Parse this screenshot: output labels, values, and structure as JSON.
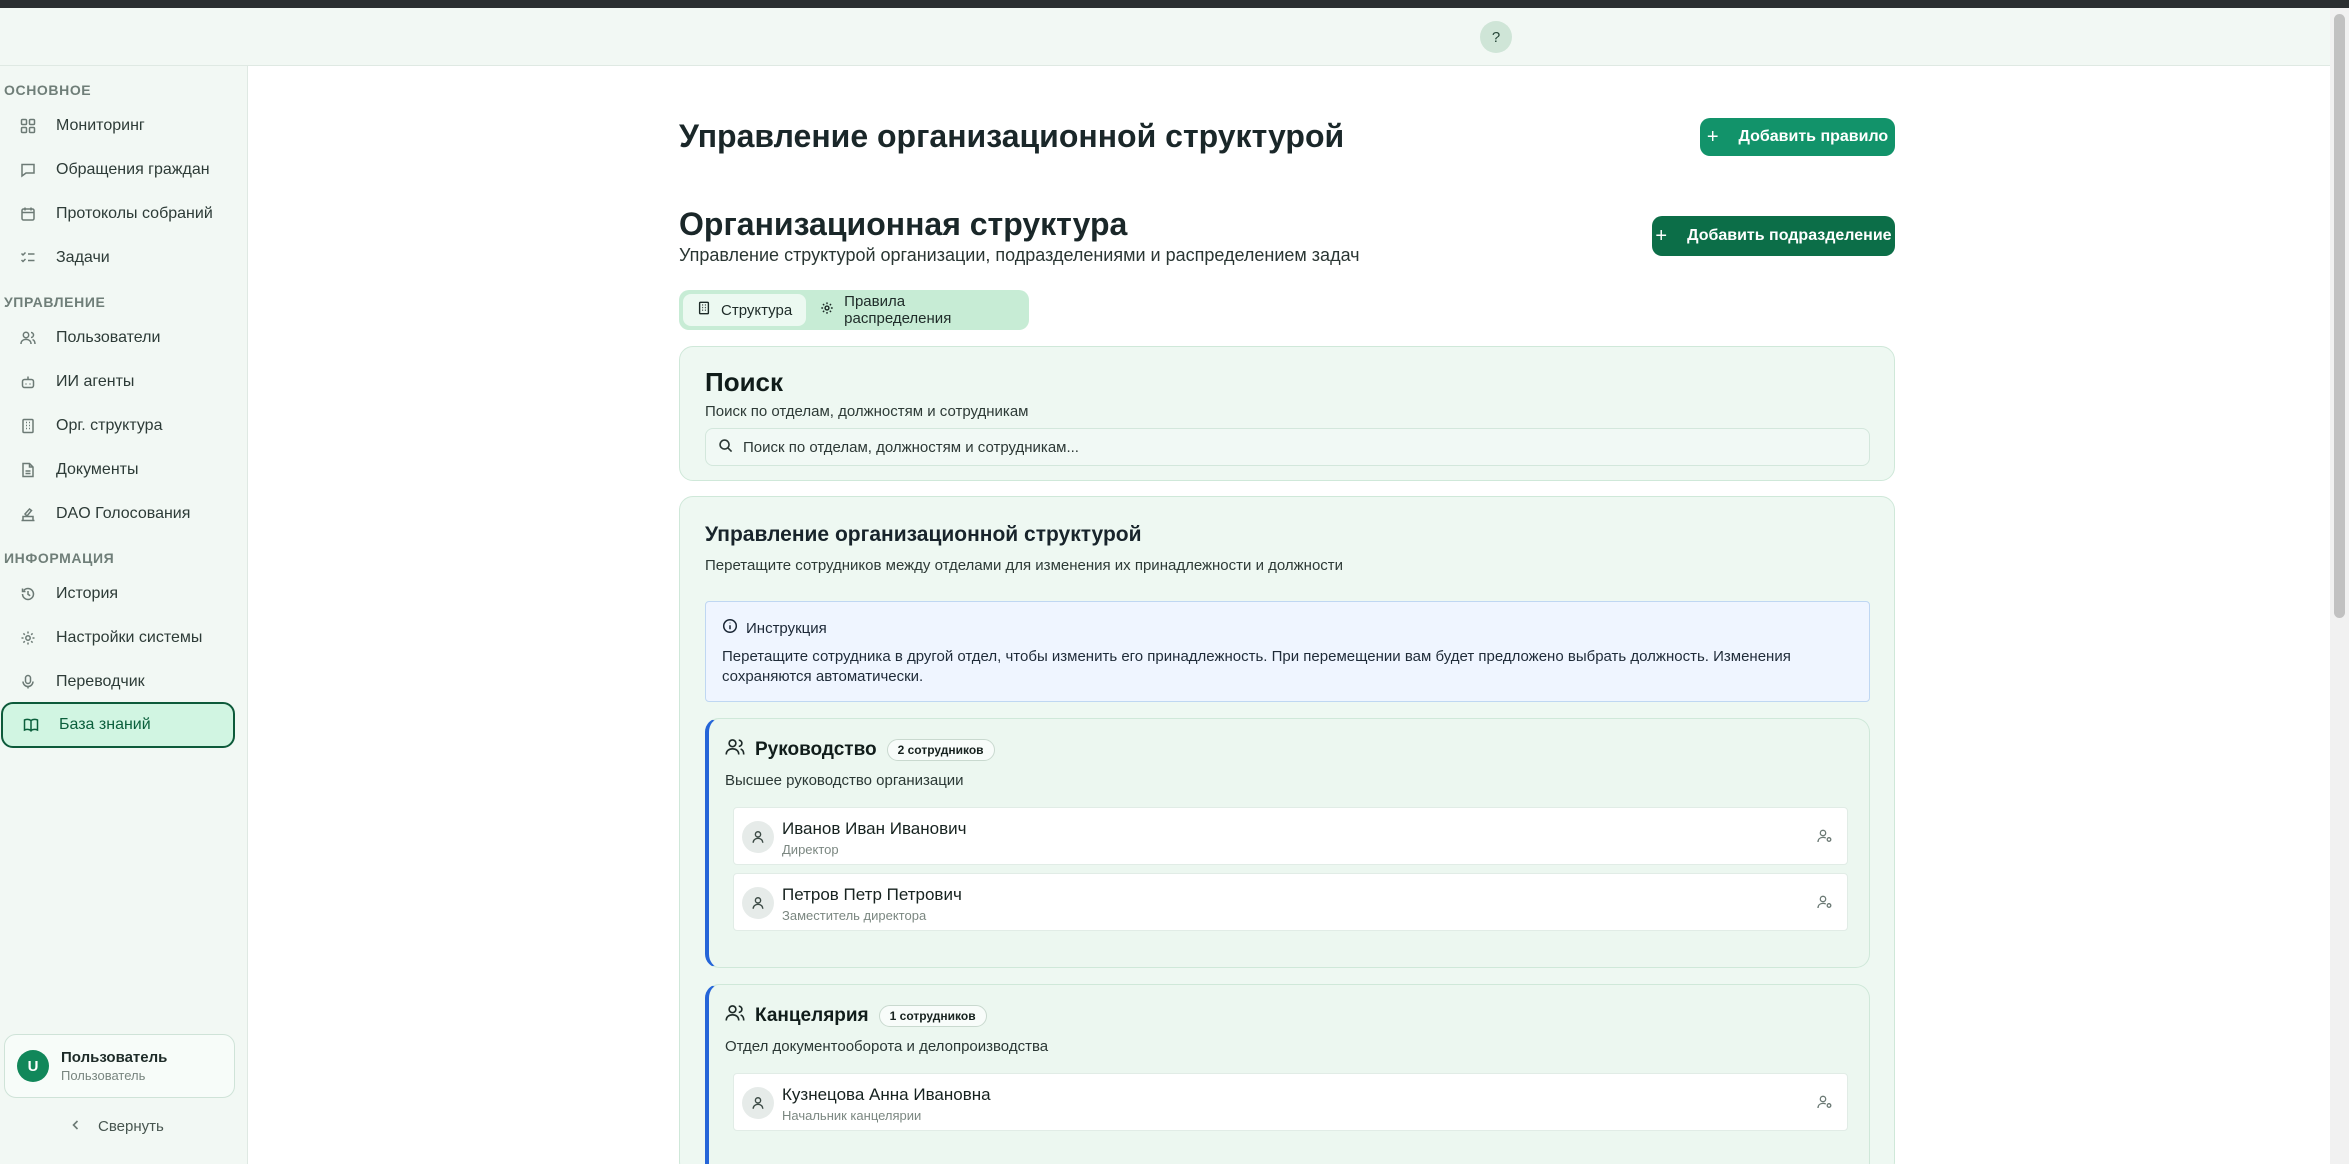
{
  "topbar": {
    "help_label": "?"
  },
  "sidebar": {
    "sections": [
      {
        "title": "ОСНОВНОЕ"
      },
      {
        "title": "УПРАВЛЕНИЕ"
      },
      {
        "title": "ИНФОРМАЦИЯ"
      }
    ],
    "items": [
      {
        "label": "Мониторинг",
        "icon": "grid-icon"
      },
      {
        "label": "Обращения граждан",
        "icon": "message-icon"
      },
      {
        "label": "Протоколы собраний",
        "icon": "calendar-icon"
      },
      {
        "label": "Задачи",
        "icon": "list-check-icon"
      },
      {
        "label": "Пользователи",
        "icon": "users-icon"
      },
      {
        "label": "ИИ агенты",
        "icon": "bot-icon"
      },
      {
        "label": "Орг. структура",
        "icon": "building-icon"
      },
      {
        "label": "Документы",
        "icon": "file-icon"
      },
      {
        "label": "DAO Голосования",
        "icon": "vote-icon"
      },
      {
        "label": "История",
        "icon": "history-icon"
      },
      {
        "label": "Настройки системы",
        "icon": "gear-icon"
      },
      {
        "label": "Переводчик",
        "icon": "mic-icon"
      },
      {
        "label": "База знаний",
        "icon": "book-icon",
        "active": true
      }
    ],
    "user": {
      "initial": "U",
      "name": "Пользователь",
      "role": "Пользователь"
    },
    "collapse_label": "Свернуть"
  },
  "header": {
    "title": "Управление организационной структурой",
    "add_rule_label": "Добавить правило"
  },
  "org": {
    "title": "Организационная структура",
    "subtitle": "Управление структурой организации, подразделениями и распределением задач",
    "add_unit_label": "Добавить подразделение",
    "tabs": [
      {
        "label": "Структура",
        "active": true
      },
      {
        "label": "Правила распределения"
      }
    ]
  },
  "search": {
    "title": "Поиск",
    "subtitle": "Поиск по отделам, должностям и сотрудникам",
    "placeholder": "Поиск по отделам, должностям и сотрудникам..."
  },
  "management": {
    "title": "Управление организационной структурой",
    "subtitle": "Перетащите сотрудников между отделами для изменения их принадлежности и должности",
    "instruction": {
      "title": "Инструкция",
      "text": "Перетащите сотрудника в другой отдел, чтобы изменить его принадлежность. При перемещении вам будет предложено выбрать должность. Изменения сохраняются автоматически."
    },
    "departments": [
      {
        "name": "Руководство",
        "badge": "2 сотрудников",
        "description": "Высшее руководство организации",
        "employees": [
          {
            "name": "Иванов Иван Иванович",
            "position": "Директор"
          },
          {
            "name": "Петров Петр Петрович",
            "position": "Заместитель директора"
          }
        ]
      },
      {
        "name": "Канцелярия",
        "badge": "1 сотрудников",
        "description": "Отдел документооборота и делопроизводства",
        "employees": [
          {
            "name": "Кузнецова Анна Ивановна",
            "position": "Начальник канцелярии"
          }
        ]
      }
    ]
  },
  "colors": {
    "accent": "#12936a",
    "accent_dark": "#0c6e48",
    "active_bg": "#d1f5e2",
    "dept_border": "#2565d8"
  }
}
